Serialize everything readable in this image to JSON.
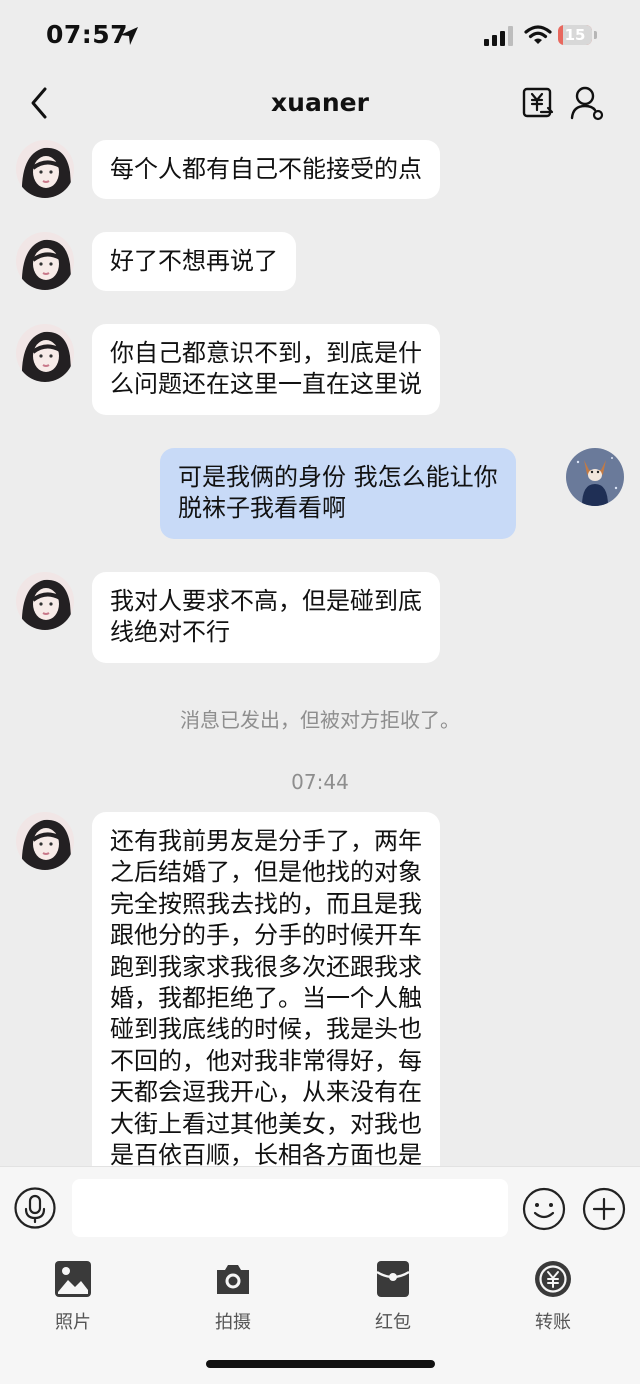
{
  "status_bar": {
    "time": "07:57",
    "battery": "15",
    "battery_level": 0.15
  },
  "header": {
    "title": "xuaner"
  },
  "messages": [
    {
      "dir": "in",
      "text": "每个人都有自己不能接受的点"
    },
    {
      "dir": "in",
      "text": "好了不想再说了"
    },
    {
      "dir": "in",
      "text": "你自己都意识不到，到底是什\n么问题还在这里一直在这里说"
    },
    {
      "dir": "out",
      "text": "可是我俩的身份 我怎么能让你\n脱袜子我看看啊"
    },
    {
      "dir": "in",
      "text": "我对人要求不高，但是碰到底\n线绝对不行"
    },
    {
      "dir": "in",
      "text": "还有我前男友是分手了，两年\n之后结婚了，但是他找的对象\n完全按照我去找的，而且是我\n跟他分的手，分手的时候开车\n跑到我家求我很多次还跟我求\n婚，我都拒绝了。当一个人触\n碰到我底线的时候，我是头也\n不回的，他对我非常得好，每\n天都会逗我开心，从来没有在\n大街上看过其他美女，对我也\n是百依百顺，长相各方面也是"
    }
  ],
  "system_notice": "消息已发出，但被对方拒收了。",
  "timestamp": "07:44",
  "input": {
    "value": ""
  },
  "tools": [
    {
      "label": "照片",
      "icon": "photo-icon"
    },
    {
      "label": "拍摄",
      "icon": "camera-icon"
    },
    {
      "label": "红包",
      "icon": "red-packet-icon"
    },
    {
      "label": "转账",
      "icon": "transfer-icon"
    }
  ],
  "colors": {
    "background": "#ededed",
    "incoming_bubble": "#ffffff",
    "outgoing_bubble": "#c8daf7",
    "battery_low": "#e8685e"
  }
}
